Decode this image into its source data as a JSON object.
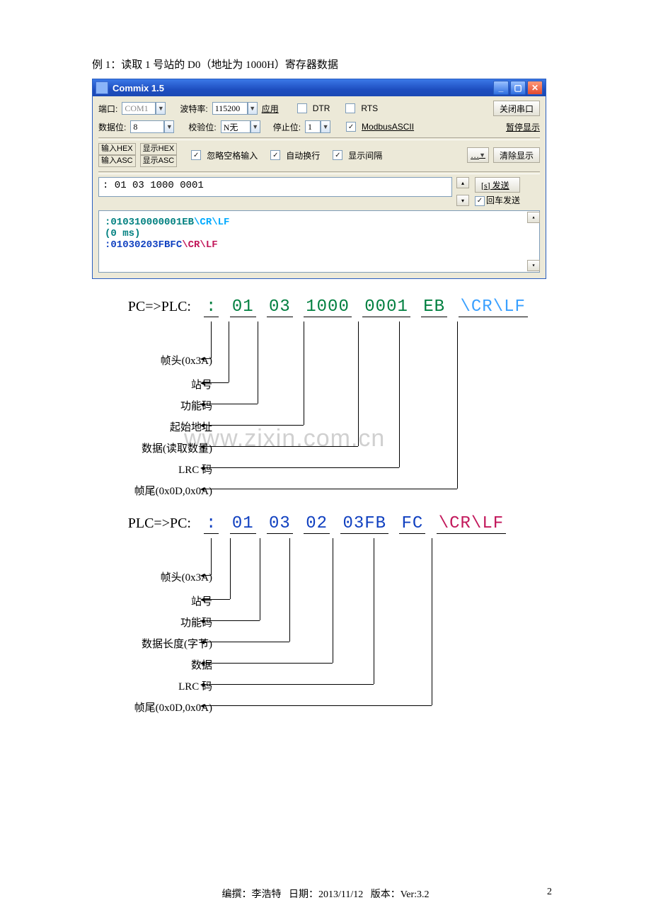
{
  "example_title": "例 1：读取 1 号站的 D0（地址为 1000H）寄存器数据",
  "app": {
    "title": "Commix 1.5",
    "labels": {
      "port": "端口:",
      "port_val": "COM1",
      "baud": "波特率:",
      "baud_val": "115200",
      "apply": "应用",
      "dtr": "DTR",
      "rts": "RTS",
      "close_port": "关闭串口",
      "databits": "数据位:",
      "databits_val": "8",
      "parity": "校验位:",
      "parity_val": "N无",
      "stopbits": "停止位:",
      "stopbits_val": "1",
      "modbus": "ModbusASCII",
      "pause": "暂停显示",
      "in_hex": "输入HEX",
      "show_hex": "显示HEX",
      "in_asc": "输入ASC",
      "show_asc": "显示ASC",
      "ignore_space": "忽略空格输入",
      "auto_wrap": "自动换行",
      "show_gap": "显示间隔",
      "more": "…",
      "clear": "清除显示",
      "send_text": ": 01 03 1000 0001",
      "send_btn": "[s] 发送",
      "enter_send": "回车发送"
    },
    "output": {
      "l1_pre": ":010310000001EB",
      "crlf": "\\CR\\LF",
      "l2": "(0 ms)",
      "l3_pre": ":01030203FBFC"
    }
  },
  "req": {
    "dir": "PC=>PLC:",
    "colon": ":",
    "s1": "01",
    "s2": "03",
    "s3": "1000",
    "s4": "0001",
    "s5": "EB",
    "s6": "\\CR\\LF",
    "a1": "帧头(0x3A)",
    "a2": "站号",
    "a3": "功能码",
    "a4": "起始地址",
    "a5": "数据(读取数量)",
    "a6": "LRC 码",
    "a7": "帧尾(0x0D,0x0A)"
  },
  "rsp": {
    "dir": "PLC=>PC:",
    "colon": ":",
    "s1": "01",
    "s2": "03",
    "s3": "02",
    "s4": "03FB",
    "s5": "FC",
    "s6": "\\CR\\LF",
    "a1": "帧头(0x3A)",
    "a2": "站号",
    "a3": "功能码",
    "a4": "数据长度(字节)",
    "a5": "数据",
    "a6": "LRC 码",
    "a7": "帧尾(0x0D,0x0A)"
  },
  "footer": {
    "author": "编撰：李浩特",
    "date": "日期：2013/11/12",
    "ver": "版本：Ver:3.2",
    "page": "2"
  }
}
